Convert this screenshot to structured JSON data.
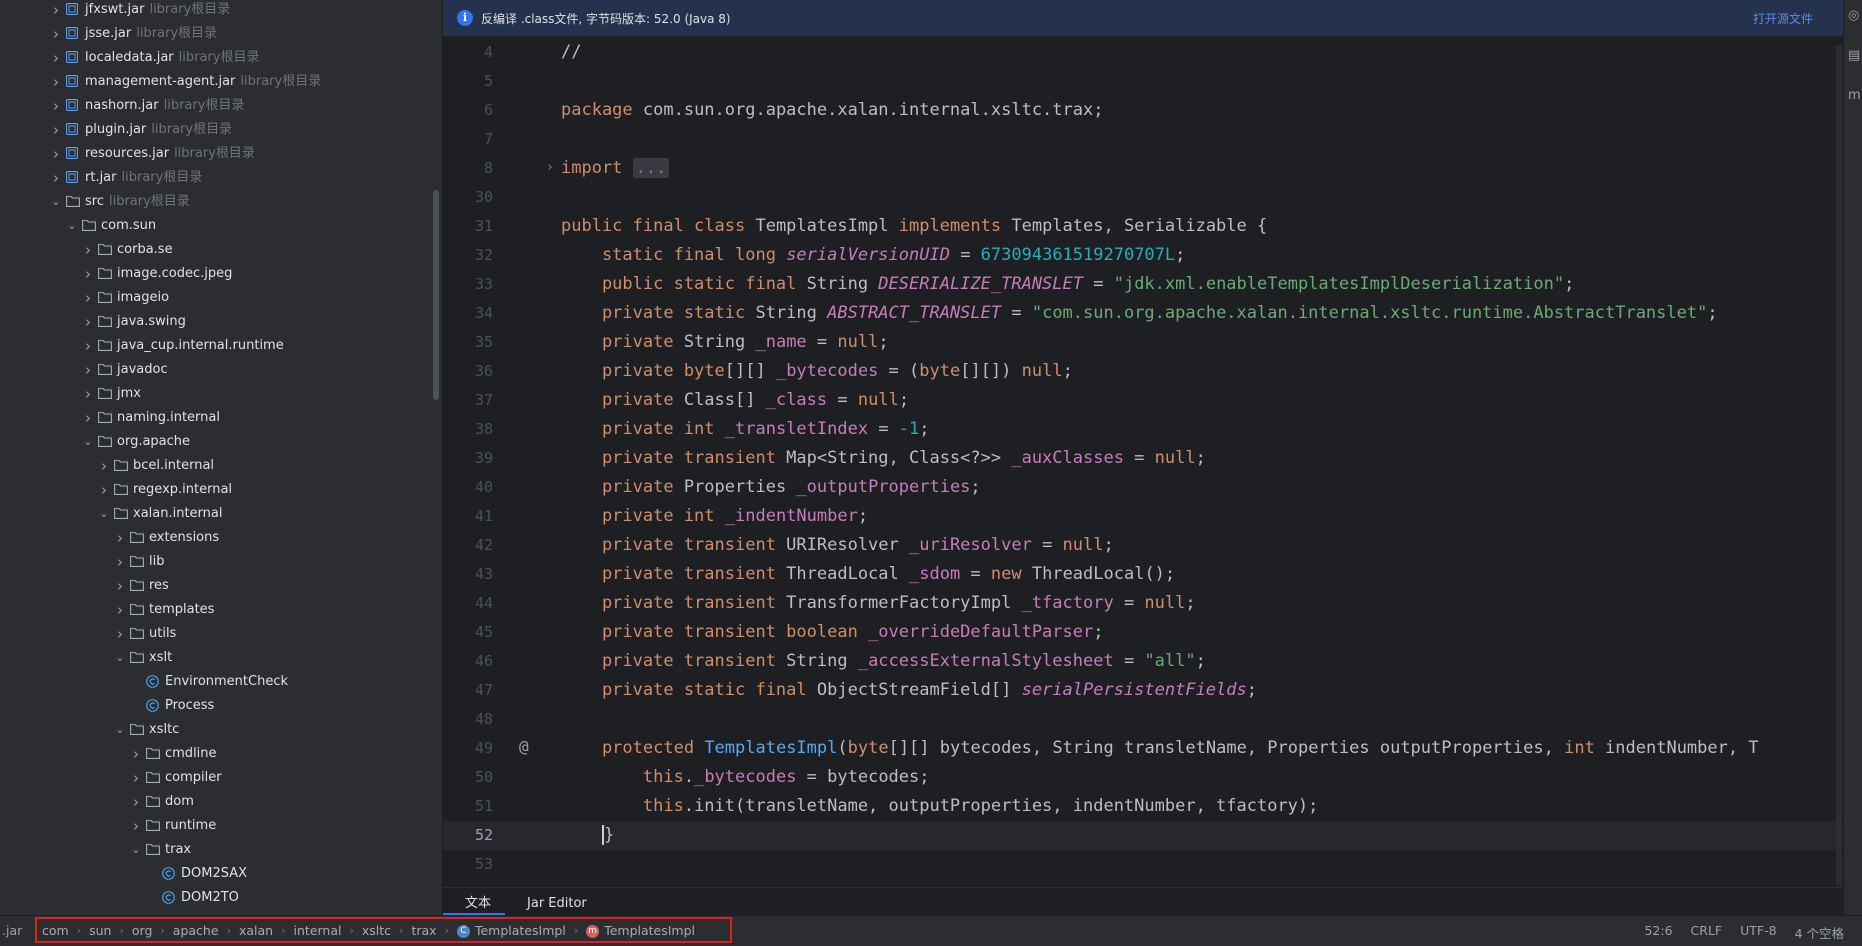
{
  "tree": {
    "rows": [
      {
        "label": "jfxswt.jar",
        "sub": "library根目录",
        "depth": 0,
        "chev": "right",
        "icon": "jar"
      },
      {
        "label": "jsse.jar",
        "sub": "library根目录",
        "depth": 0,
        "chev": "right",
        "icon": "jar"
      },
      {
        "label": "localedata.jar",
        "sub": "library根目录",
        "depth": 0,
        "chev": "right",
        "icon": "jar"
      },
      {
        "label": "management-agent.jar",
        "sub": "library根目录",
        "depth": 0,
        "chev": "right",
        "icon": "jar"
      },
      {
        "label": "nashorn.jar",
        "sub": "library根目录",
        "depth": 0,
        "chev": "right",
        "icon": "jar"
      },
      {
        "label": "plugin.jar",
        "sub": "library根目录",
        "depth": 0,
        "chev": "right",
        "icon": "jar"
      },
      {
        "label": "resources.jar",
        "sub": "library根目录",
        "depth": 0,
        "chev": "right",
        "icon": "jar"
      },
      {
        "label": "rt.jar",
        "sub": "library根目录",
        "depth": 0,
        "chev": "right",
        "icon": "jar"
      },
      {
        "label": "src",
        "sub": "library根目录",
        "depth": 0,
        "chev": "down",
        "icon": "folder"
      },
      {
        "label": "com.sun",
        "sub": "",
        "depth": 1,
        "chev": "down",
        "icon": "folder"
      },
      {
        "label": "corba.se",
        "sub": "",
        "depth": 2,
        "chev": "right",
        "icon": "folder"
      },
      {
        "label": "image.codec.jpeg",
        "sub": "",
        "depth": 2,
        "chev": "right",
        "icon": "folder"
      },
      {
        "label": "imageio",
        "sub": "",
        "depth": 2,
        "chev": "right",
        "icon": "folder"
      },
      {
        "label": "java.swing",
        "sub": "",
        "depth": 2,
        "chev": "right",
        "icon": "folder"
      },
      {
        "label": "java_cup.internal.runtime",
        "sub": "",
        "depth": 2,
        "chev": "right",
        "icon": "folder"
      },
      {
        "label": "javadoc",
        "sub": "",
        "depth": 2,
        "chev": "right",
        "icon": "folder"
      },
      {
        "label": "jmx",
        "sub": "",
        "depth": 2,
        "chev": "right",
        "icon": "folder"
      },
      {
        "label": "naming.internal",
        "sub": "",
        "depth": 2,
        "chev": "right",
        "icon": "folder"
      },
      {
        "label": "org.apache",
        "sub": "",
        "depth": 2,
        "chev": "down",
        "icon": "folder"
      },
      {
        "label": "bcel.internal",
        "sub": "",
        "depth": 3,
        "chev": "right",
        "icon": "folder"
      },
      {
        "label": "regexp.internal",
        "sub": "",
        "depth": 3,
        "chev": "right",
        "icon": "folder"
      },
      {
        "label": "xalan.internal",
        "sub": "",
        "depth": 3,
        "chev": "down",
        "icon": "folder"
      },
      {
        "label": "extensions",
        "sub": "",
        "depth": 4,
        "chev": "right",
        "icon": "folder"
      },
      {
        "label": "lib",
        "sub": "",
        "depth": 4,
        "chev": "right",
        "icon": "folder"
      },
      {
        "label": "res",
        "sub": "",
        "depth": 4,
        "chev": "right",
        "icon": "folder"
      },
      {
        "label": "templates",
        "sub": "",
        "depth": 4,
        "chev": "right",
        "icon": "folder"
      },
      {
        "label": "utils",
        "sub": "",
        "depth": 4,
        "chev": "right",
        "icon": "folder"
      },
      {
        "label": "xslt",
        "sub": "",
        "depth": 4,
        "chev": "down",
        "icon": "folder"
      },
      {
        "label": "EnvironmentCheck",
        "sub": "",
        "depth": 5,
        "chev": "none",
        "icon": "class"
      },
      {
        "label": "Process",
        "sub": "",
        "depth": 5,
        "chev": "none",
        "icon": "class"
      },
      {
        "label": "xsltc",
        "sub": "",
        "depth": 4,
        "chev": "down",
        "icon": "folder"
      },
      {
        "label": "cmdline",
        "sub": "",
        "depth": 5,
        "chev": "right",
        "icon": "folder"
      },
      {
        "label": "compiler",
        "sub": "",
        "depth": 5,
        "chev": "right",
        "icon": "folder"
      },
      {
        "label": "dom",
        "sub": "",
        "depth": 5,
        "chev": "right",
        "icon": "folder"
      },
      {
        "label": "runtime",
        "sub": "",
        "depth": 5,
        "chev": "right",
        "icon": "folder"
      },
      {
        "label": "trax",
        "sub": "",
        "depth": 5,
        "chev": "down",
        "icon": "folder"
      },
      {
        "label": "DOM2SAX",
        "sub": "",
        "depth": 6,
        "chev": "none",
        "icon": "class"
      },
      {
        "label": "DOM2TO",
        "sub": "",
        "depth": 6,
        "chev": "none",
        "icon": "class"
      }
    ]
  },
  "banner": {
    "icon": "info-icon",
    "text": "反编译 .class文件, 字节码版本: 52.0 (Java 8)",
    "link": "打开源文件"
  },
  "code": {
    "current_line": 52,
    "lines": [
      {
        "n": "4",
        "toks": [
          [
            "//",
            ""
          ]
        ]
      },
      {
        "n": "5",
        "toks": []
      },
      {
        "n": "6",
        "toks": [
          [
            "package",
            "kw"
          ],
          [
            " com.sun.org.apache.xalan.internal.xsltc.trax;",
            ""
          ]
        ]
      },
      {
        "n": "7",
        "toks": []
      },
      {
        "n": "8",
        "toks": [
          [
            "import",
            "kw"
          ],
          [
            " ",
            ""
          ],
          [
            "...",
            "fold"
          ]
        ]
      },
      {
        "n": "30",
        "toks": []
      },
      {
        "n": "31",
        "toks": [
          [
            "public final class",
            "kw"
          ],
          [
            " TemplatesImpl ",
            ""
          ],
          [
            "implements",
            "kw"
          ],
          [
            " Templates, Serializable {",
            ""
          ]
        ]
      },
      {
        "n": "32",
        "toks": [
          [
            "    static final long",
            "kw"
          ],
          [
            " ",
            ""
          ],
          [
            "serialVersionUID",
            "sf"
          ],
          [
            " = ",
            ""
          ],
          [
            "673094361519270707L",
            "nm"
          ],
          [
            ";",
            ""
          ]
        ]
      },
      {
        "n": "33",
        "toks": [
          [
            "    public static final",
            "kw"
          ],
          [
            " String ",
            ""
          ],
          [
            "DESERIALIZE_TRANSLET",
            "sf"
          ],
          [
            " = ",
            ""
          ],
          [
            "\"jdk.xml.enableTemplatesImplDeserialization\"",
            "st"
          ],
          [
            ";",
            ""
          ]
        ]
      },
      {
        "n": "34",
        "toks": [
          [
            "    private static",
            "kw"
          ],
          [
            " String ",
            ""
          ],
          [
            "ABSTRACT_TRANSLET",
            "sf"
          ],
          [
            " = ",
            ""
          ],
          [
            "\"com.sun.org.apache.xalan.internal.xsltc.runtime.AbstractTranslet\"",
            "st"
          ],
          [
            ";",
            ""
          ]
        ]
      },
      {
        "n": "35",
        "toks": [
          [
            "    private",
            "kw"
          ],
          [
            " String ",
            ""
          ],
          [
            "_name",
            "fd"
          ],
          [
            " = ",
            ""
          ],
          [
            "null",
            "kw"
          ],
          [
            ";",
            ""
          ]
        ]
      },
      {
        "n": "36",
        "toks": [
          [
            "    private byte",
            "kw"
          ],
          [
            "[][] ",
            ""
          ],
          [
            "_bytecodes",
            "fd"
          ],
          [
            " = (",
            ""
          ],
          [
            "byte",
            "kw"
          ],
          [
            "[][]) ",
            ""
          ],
          [
            "null",
            "kw"
          ],
          [
            ";",
            ""
          ]
        ]
      },
      {
        "n": "37",
        "toks": [
          [
            "    private",
            "kw"
          ],
          [
            " Class[] ",
            ""
          ],
          [
            "_class",
            "fd"
          ],
          [
            " = ",
            ""
          ],
          [
            "null",
            "kw"
          ],
          [
            ";",
            ""
          ]
        ]
      },
      {
        "n": "38",
        "toks": [
          [
            "    private int",
            "kw"
          ],
          [
            " ",
            ""
          ],
          [
            "_transletIndex",
            "fd"
          ],
          [
            " = ",
            ""
          ],
          [
            "-1",
            "nm"
          ],
          [
            ";",
            ""
          ]
        ]
      },
      {
        "n": "39",
        "toks": [
          [
            "    private transient",
            "kw"
          ],
          [
            " Map<String, Class<?>> ",
            ""
          ],
          [
            "_auxClasses",
            "fd"
          ],
          [
            " = ",
            ""
          ],
          [
            "null",
            "kw"
          ],
          [
            ";",
            ""
          ]
        ]
      },
      {
        "n": "40",
        "toks": [
          [
            "    private",
            "kw"
          ],
          [
            " Properties ",
            ""
          ],
          [
            "_outputProperties",
            "fd"
          ],
          [
            ";",
            ""
          ]
        ]
      },
      {
        "n": "41",
        "toks": [
          [
            "    private int",
            "kw"
          ],
          [
            " ",
            ""
          ],
          [
            "_indentNumber",
            "fd"
          ],
          [
            ";",
            ""
          ]
        ]
      },
      {
        "n": "42",
        "toks": [
          [
            "    private transient",
            "kw"
          ],
          [
            " URIResolver ",
            ""
          ],
          [
            "_uriResolver",
            "fd"
          ],
          [
            " = ",
            ""
          ],
          [
            "null",
            "kw"
          ],
          [
            ";",
            ""
          ]
        ]
      },
      {
        "n": "43",
        "toks": [
          [
            "    private transient",
            "kw"
          ],
          [
            " ThreadLocal ",
            ""
          ],
          [
            "_sdom",
            "fd"
          ],
          [
            " = ",
            ""
          ],
          [
            "new",
            "kw"
          ],
          [
            " ThreadLocal();",
            ""
          ]
        ]
      },
      {
        "n": "44",
        "toks": [
          [
            "    private transient",
            "kw"
          ],
          [
            " TransformerFactoryImpl ",
            ""
          ],
          [
            "_tfactory",
            "fd"
          ],
          [
            " = ",
            ""
          ],
          [
            "null",
            "kw"
          ],
          [
            ";",
            ""
          ]
        ]
      },
      {
        "n": "45",
        "toks": [
          [
            "    private transient boolean",
            "kw"
          ],
          [
            " ",
            ""
          ],
          [
            "_overrideDefaultParser",
            "fd"
          ],
          [
            ";",
            ""
          ]
        ]
      },
      {
        "n": "46",
        "toks": [
          [
            "    private transient",
            "kw"
          ],
          [
            " String ",
            ""
          ],
          [
            "_accessExternalStylesheet",
            "fd"
          ],
          [
            " = ",
            ""
          ],
          [
            "\"all\"",
            "st"
          ],
          [
            ";",
            ""
          ]
        ]
      },
      {
        "n": "47",
        "toks": [
          [
            "    private static final",
            "kw"
          ],
          [
            " ObjectStreamField[] ",
            ""
          ],
          [
            "serialPersistentFields",
            "sf"
          ],
          [
            ";",
            ""
          ]
        ]
      },
      {
        "n": "48",
        "toks": []
      },
      {
        "n": "49",
        "toks": [
          [
            "    protected",
            "kw"
          ],
          [
            " ",
            ""
          ],
          [
            "TemplatesImpl",
            "mt"
          ],
          [
            "(",
            ""
          ],
          [
            "byte",
            "kw"
          ],
          [
            "[][] bytecodes, String transletName, Properties outputProperties, ",
            ""
          ],
          [
            "int",
            "kw"
          ],
          [
            " indentNumber, T",
            ""
          ]
        ]
      },
      {
        "n": "50",
        "toks": [
          [
            "        this",
            "kw"
          ],
          [
            ".",
            ""
          ],
          [
            "_bytecodes",
            "fd"
          ],
          [
            " = bytecodes;",
            ""
          ]
        ]
      },
      {
        "n": "51",
        "toks": [
          [
            "        this",
            "kw"
          ],
          [
            ".init(transletName, outputProperties, indentNumber, tfactory);",
            ""
          ]
        ]
      },
      {
        "n": "52",
        "toks": [
          [
            "    ",
            ""
          ],
          [
            "|",
            "caret"
          ],
          [
            "}",
            ""
          ]
        ]
      },
      {
        "n": "53",
        "toks": []
      }
    ]
  },
  "editor_tabs": [
    "文本",
    "Jar Editor"
  ],
  "status": {
    "jar_label": ".jar",
    "breadcrumbs": [
      "com",
      "sun",
      "org",
      "apache",
      "xalan",
      "internal",
      "xsltc",
      "trax"
    ],
    "class_crumbs": [
      {
        "label": "TemplatesImpl",
        "icon": "C"
      },
      {
        "label": "TemplatesImpl",
        "icon": "m"
      }
    ],
    "position": "52:6",
    "line_sep": "CRLF",
    "encoding": "UTF-8",
    "indent": "4 个空格"
  }
}
